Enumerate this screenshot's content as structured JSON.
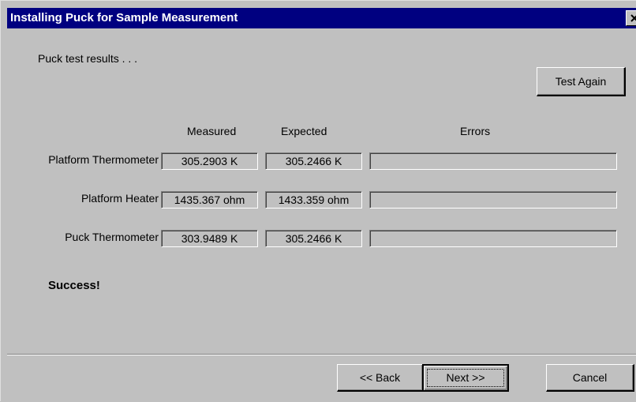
{
  "window": {
    "title": "Installing Puck for Sample Measurement",
    "close_icon": "close-icon"
  },
  "intro_text": "Puck test results . . .",
  "test_again_label": "Test Again",
  "columns": {
    "measured": "Measured",
    "expected": "Expected",
    "errors": "Errors"
  },
  "rows": [
    {
      "label": "Platform Thermometer",
      "measured": "305.2903 K",
      "expected": "305.2466 K",
      "errors": ""
    },
    {
      "label": "Platform Heater",
      "measured": "1435.367 ohm",
      "expected": "1433.359 ohm",
      "errors": ""
    },
    {
      "label": "Puck Thermometer",
      "measured": "303.9489 K",
      "expected": "305.2466 K",
      "errors": ""
    }
  ],
  "status_text": "Success!",
  "buttons": {
    "back": "<< Back",
    "next": "Next >>",
    "cancel": "Cancel"
  },
  "colors": {
    "title_bar": "#000080",
    "face": "#c0c0c0"
  }
}
